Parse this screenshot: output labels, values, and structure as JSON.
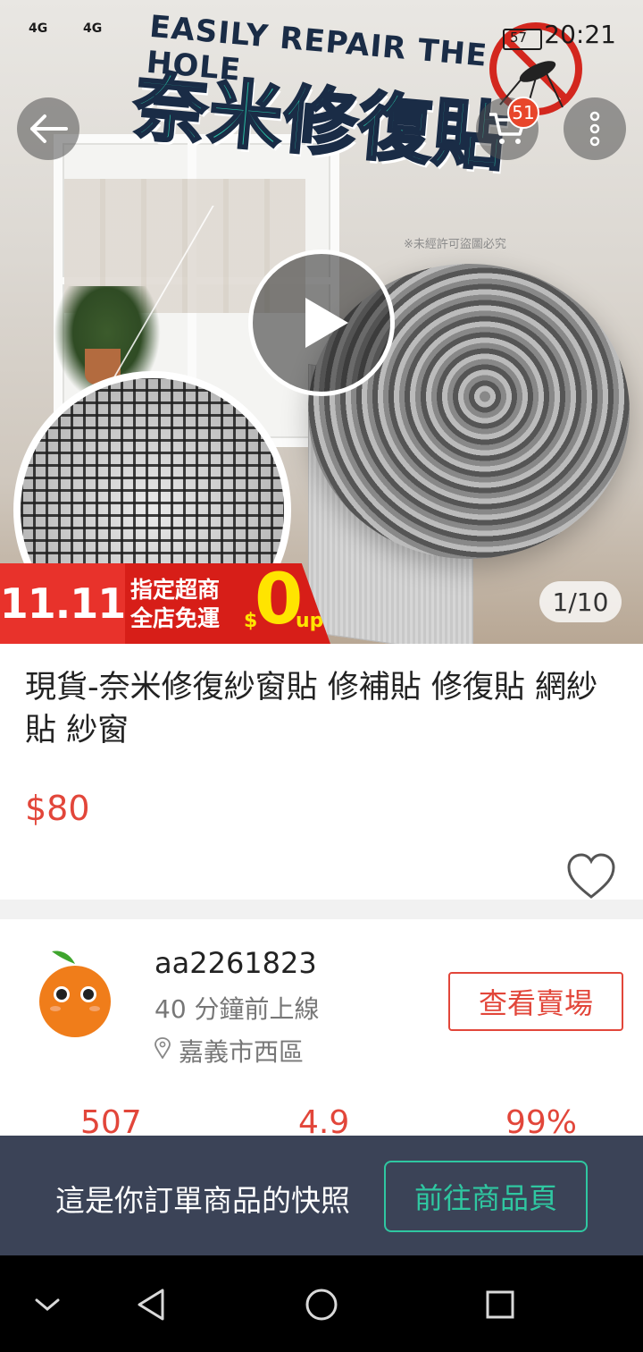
{
  "status_bar": {
    "network_label_1": "4G",
    "network_label_2": "4G",
    "battery_label": "57",
    "time": "20:21"
  },
  "header": {
    "back_icon": "arrow-left-icon",
    "cart_icon": "cart-icon",
    "cart_badge": "51",
    "more_icon": "more-vertical-icon"
  },
  "hero": {
    "headline_en": "EASILY REPAIR THE HOLE",
    "headline_cn": "奈米修復貼",
    "watermark": "※未經許可盜圖必究",
    "counter": "1/10",
    "play_icon": "play-icon"
  },
  "promo": {
    "date_label": "11.11",
    "line1": "指定超商",
    "line2": "全店免運",
    "currency": "$",
    "amount": "0",
    "suffix": "up"
  },
  "product": {
    "title": "現貨-奈米修復紗窗貼 修補貼 修復貼 網紗貼 紗窗",
    "price": "$80",
    "favorite_icon": "heart-icon"
  },
  "seller": {
    "name": "aa2261823",
    "status": "40 分鐘前上線",
    "location": "嘉義市西區",
    "visit_button": "查看賣場",
    "avatar_icon": "orange-avatar-icon",
    "location_icon": "location-pin-icon"
  },
  "stats": [
    "507",
    "4.9",
    "99%"
  ],
  "snapshot": {
    "text": "這是你訂單商品的快照",
    "button": "前往商品頁"
  },
  "colors": {
    "accent": "#e2463a",
    "teal": "#2fc7a1",
    "snapshot_bg": "#3b4357"
  },
  "navbar": {
    "items": [
      "chevron-down-icon",
      "back-triangle-icon",
      "home-circle-icon",
      "recents-square-icon"
    ]
  }
}
